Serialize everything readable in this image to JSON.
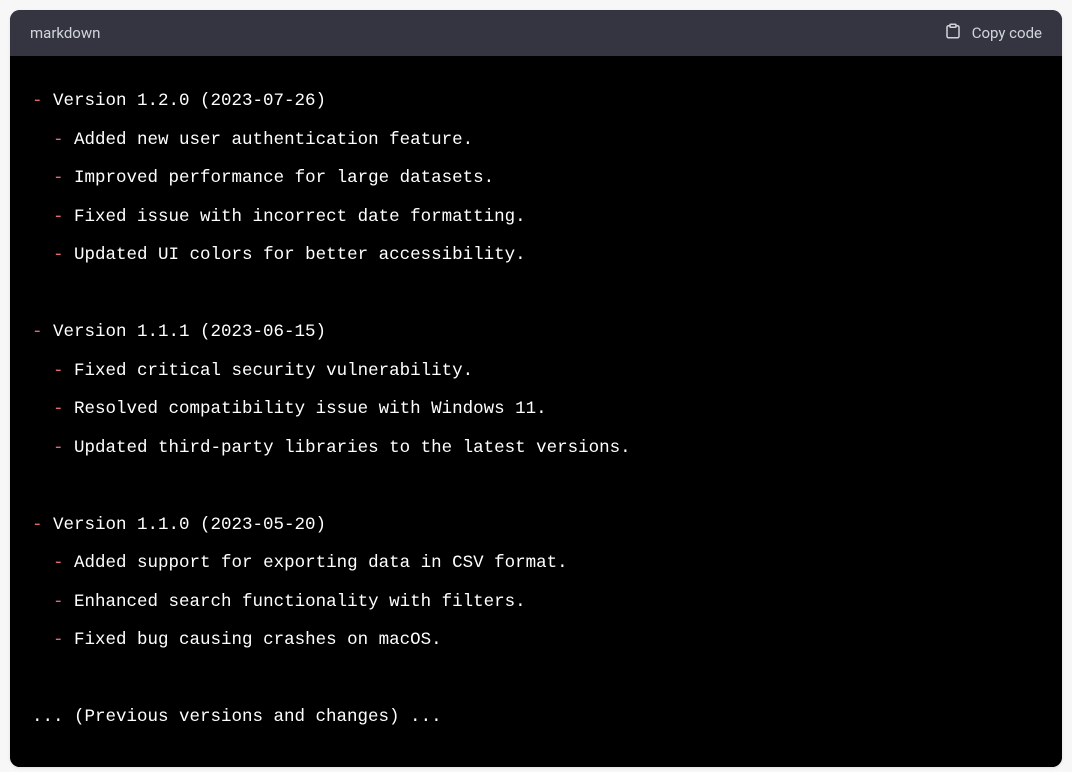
{
  "header": {
    "language_label": "markdown",
    "copy_label": "Copy code"
  },
  "changelog": {
    "versions": [
      {
        "title": "Version 1.2.0 (2023-07-26)",
        "items": [
          "Added new user authentication feature.",
          "Improved performance for large datasets.",
          "Fixed issue with incorrect date formatting.",
          "Updated UI colors for better accessibility."
        ]
      },
      {
        "title": "Version 1.1.1 (2023-06-15)",
        "items": [
          "Fixed critical security vulnerability.",
          "Resolved compatibility issue with Windows 11.",
          "Updated third-party libraries to the latest versions."
        ]
      },
      {
        "title": "Version 1.1.0 (2023-05-20)",
        "items": [
          "Added support for exporting data in CSV format.",
          "Enhanced search functionality with filters.",
          "Fixed bug causing crashes on macOS."
        ]
      }
    ],
    "footer": "... (Previous versions and changes) ..."
  }
}
